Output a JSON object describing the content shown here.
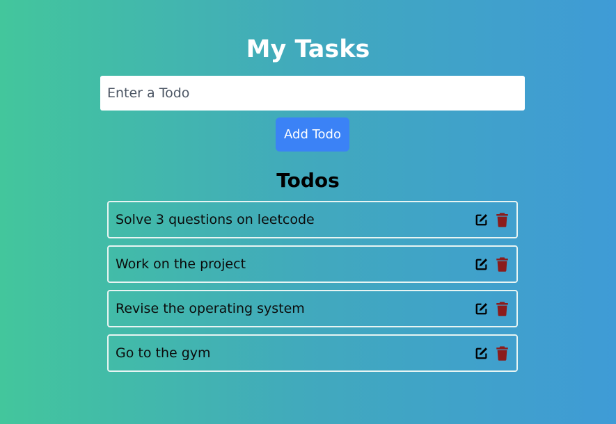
{
  "header": {
    "title": "My Tasks"
  },
  "form": {
    "input_value": "",
    "input_placeholder": "Enter a Todo",
    "add_label": "Add Todo"
  },
  "list": {
    "heading": "Todos",
    "items": [
      {
        "text": "Solve 3 questions on leetcode",
        "edit_icon": "edit-icon",
        "delete_icon": "trash-icon"
      },
      {
        "text": "Work on the project",
        "edit_icon": "edit-icon",
        "delete_icon": "trash-icon"
      },
      {
        "text": "Revise the operating system",
        "edit_icon": "edit-icon",
        "delete_icon": "trash-icon"
      },
      {
        "text": "Go to the gym",
        "edit_icon": "edit-icon",
        "delete_icon": "trash-icon"
      }
    ]
  },
  "colors": {
    "gradient_start": "#43c69c",
    "gradient_end": "#3f9bd6",
    "button": "#3b82f6",
    "delete_icon": "#8b1c1c",
    "edit_icon": "#000000"
  }
}
